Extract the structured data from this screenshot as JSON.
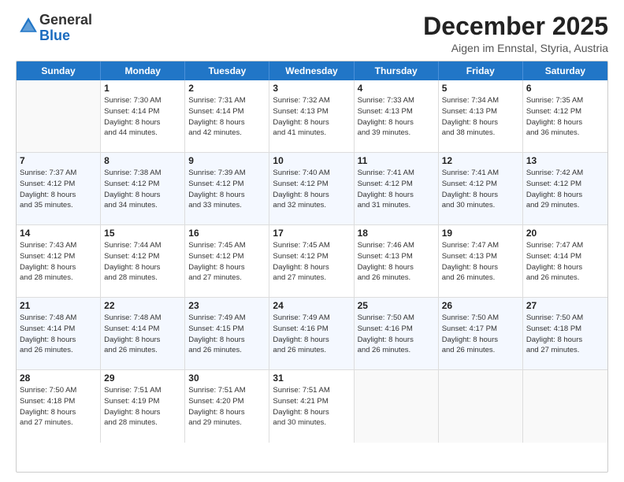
{
  "logo": {
    "general": "General",
    "blue": "Blue"
  },
  "header": {
    "month": "December 2025",
    "location": "Aigen im Ennstal, Styria, Austria"
  },
  "weekdays": [
    "Sunday",
    "Monday",
    "Tuesday",
    "Wednesday",
    "Thursday",
    "Friday",
    "Saturday"
  ],
  "rows": [
    [
      {
        "day": "",
        "info": ""
      },
      {
        "day": "1",
        "info": "Sunrise: 7:30 AM\nSunset: 4:14 PM\nDaylight: 8 hours\nand 44 minutes."
      },
      {
        "day": "2",
        "info": "Sunrise: 7:31 AM\nSunset: 4:14 PM\nDaylight: 8 hours\nand 42 minutes."
      },
      {
        "day": "3",
        "info": "Sunrise: 7:32 AM\nSunset: 4:13 PM\nDaylight: 8 hours\nand 41 minutes."
      },
      {
        "day": "4",
        "info": "Sunrise: 7:33 AM\nSunset: 4:13 PM\nDaylight: 8 hours\nand 39 minutes."
      },
      {
        "day": "5",
        "info": "Sunrise: 7:34 AM\nSunset: 4:13 PM\nDaylight: 8 hours\nand 38 minutes."
      },
      {
        "day": "6",
        "info": "Sunrise: 7:35 AM\nSunset: 4:12 PM\nDaylight: 8 hours\nand 36 minutes."
      }
    ],
    [
      {
        "day": "7",
        "info": "Sunrise: 7:37 AM\nSunset: 4:12 PM\nDaylight: 8 hours\nand 35 minutes."
      },
      {
        "day": "8",
        "info": "Sunrise: 7:38 AM\nSunset: 4:12 PM\nDaylight: 8 hours\nand 34 minutes."
      },
      {
        "day": "9",
        "info": "Sunrise: 7:39 AM\nSunset: 4:12 PM\nDaylight: 8 hours\nand 33 minutes."
      },
      {
        "day": "10",
        "info": "Sunrise: 7:40 AM\nSunset: 4:12 PM\nDaylight: 8 hours\nand 32 minutes."
      },
      {
        "day": "11",
        "info": "Sunrise: 7:41 AM\nSunset: 4:12 PM\nDaylight: 8 hours\nand 31 minutes."
      },
      {
        "day": "12",
        "info": "Sunrise: 7:41 AM\nSunset: 4:12 PM\nDaylight: 8 hours\nand 30 minutes."
      },
      {
        "day": "13",
        "info": "Sunrise: 7:42 AM\nSunset: 4:12 PM\nDaylight: 8 hours\nand 29 minutes."
      }
    ],
    [
      {
        "day": "14",
        "info": "Sunrise: 7:43 AM\nSunset: 4:12 PM\nDaylight: 8 hours\nand 28 minutes."
      },
      {
        "day": "15",
        "info": "Sunrise: 7:44 AM\nSunset: 4:12 PM\nDaylight: 8 hours\nand 28 minutes."
      },
      {
        "day": "16",
        "info": "Sunrise: 7:45 AM\nSunset: 4:12 PM\nDaylight: 8 hours\nand 27 minutes."
      },
      {
        "day": "17",
        "info": "Sunrise: 7:45 AM\nSunset: 4:12 PM\nDaylight: 8 hours\nand 27 minutes."
      },
      {
        "day": "18",
        "info": "Sunrise: 7:46 AM\nSunset: 4:13 PM\nDaylight: 8 hours\nand 26 minutes."
      },
      {
        "day": "19",
        "info": "Sunrise: 7:47 AM\nSunset: 4:13 PM\nDaylight: 8 hours\nand 26 minutes."
      },
      {
        "day": "20",
        "info": "Sunrise: 7:47 AM\nSunset: 4:14 PM\nDaylight: 8 hours\nand 26 minutes."
      }
    ],
    [
      {
        "day": "21",
        "info": "Sunrise: 7:48 AM\nSunset: 4:14 PM\nDaylight: 8 hours\nand 26 minutes."
      },
      {
        "day": "22",
        "info": "Sunrise: 7:48 AM\nSunset: 4:14 PM\nDaylight: 8 hours\nand 26 minutes."
      },
      {
        "day": "23",
        "info": "Sunrise: 7:49 AM\nSunset: 4:15 PM\nDaylight: 8 hours\nand 26 minutes."
      },
      {
        "day": "24",
        "info": "Sunrise: 7:49 AM\nSunset: 4:16 PM\nDaylight: 8 hours\nand 26 minutes."
      },
      {
        "day": "25",
        "info": "Sunrise: 7:50 AM\nSunset: 4:16 PM\nDaylight: 8 hours\nand 26 minutes."
      },
      {
        "day": "26",
        "info": "Sunrise: 7:50 AM\nSunset: 4:17 PM\nDaylight: 8 hours\nand 26 minutes."
      },
      {
        "day": "27",
        "info": "Sunrise: 7:50 AM\nSunset: 4:18 PM\nDaylight: 8 hours\nand 27 minutes."
      }
    ],
    [
      {
        "day": "28",
        "info": "Sunrise: 7:50 AM\nSunset: 4:18 PM\nDaylight: 8 hours\nand 27 minutes."
      },
      {
        "day": "29",
        "info": "Sunrise: 7:51 AM\nSunset: 4:19 PM\nDaylight: 8 hours\nand 28 minutes."
      },
      {
        "day": "30",
        "info": "Sunrise: 7:51 AM\nSunset: 4:20 PM\nDaylight: 8 hours\nand 29 minutes."
      },
      {
        "day": "31",
        "info": "Sunrise: 7:51 AM\nSunset: 4:21 PM\nDaylight: 8 hours\nand 30 minutes."
      },
      {
        "day": "",
        "info": ""
      },
      {
        "day": "",
        "info": ""
      },
      {
        "day": "",
        "info": ""
      }
    ]
  ]
}
